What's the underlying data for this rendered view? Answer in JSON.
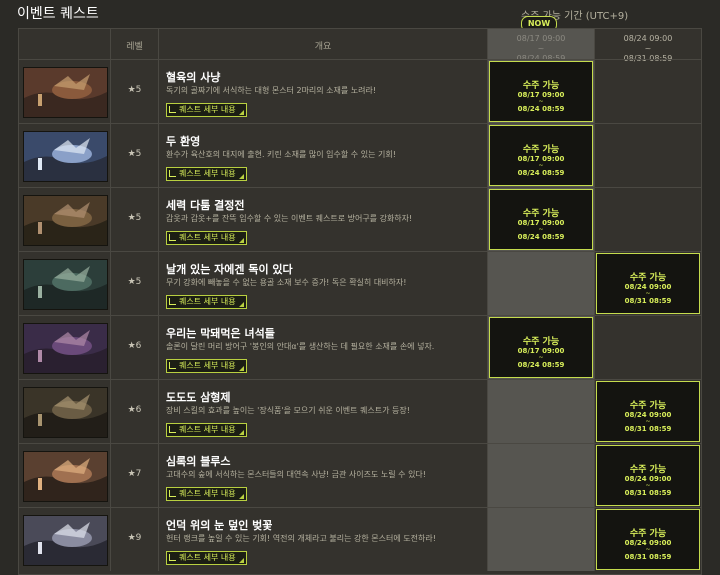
{
  "page_title": "이벤트 퀘스트",
  "period_caption": "수주 가능 기간 (UTC+9)",
  "now_badge": "NOW",
  "header": {
    "level": "레벨",
    "summary": "개요",
    "period1": {
      "start": "08/17 09:00",
      "tilde": "~",
      "end": "08/24 08:59"
    },
    "period2": {
      "start": "08/24 09:00",
      "tilde": "~",
      "end": "08/31 08:59"
    }
  },
  "detail_label": "퀘스트 세부 내용",
  "avail_label": "수주 가능",
  "quests": [
    {
      "name": "혈육의 사냥",
      "level": "★5",
      "desc": "독기의 골짜기에 서식하는 대형 몬스터 2마리의 소재를 노려라!",
      "period": 1,
      "start": "08/17 09:00",
      "tilde": "~",
      "end": "08/24 08:59"
    },
    {
      "name": "두 환영",
      "level": "★5",
      "desc": "환수가 육산호의 대지에 출현. 키린 소재를 많이 입수할 수 있는 기회!",
      "period": 1,
      "start": "08/17 09:00",
      "tilde": "~",
      "end": "08/24 08:59"
    },
    {
      "name": "세력 다툼 결정전",
      "level": "★5",
      "desc": "갑옷과 갑옷+를 잔뜩 입수할 수 있는 이벤트 퀘스트로 방어구를 강화하자!",
      "period": 1,
      "start": "08/17 09:00",
      "tilde": "~",
      "end": "08/24 08:59"
    },
    {
      "name": "날개 있는 자에겐 독이 있다",
      "level": "★5",
      "desc": "무기 강화에 빼놓을 수 없는 용골 소재 보수 증가! 독은 확실히 대비하자!",
      "period": 2,
      "start": "08/24 09:00",
      "tilde": "~",
      "end": "08/31 08:59"
    },
    {
      "name": "우리는 막돼먹은 녀석들",
      "level": "★6",
      "desc": "솔론이 달린 머리 방어구 '봉인의 안대α'를 생산하는 데 필요한 소재를 손에 넣자.",
      "period": 1,
      "start": "08/17 09:00",
      "tilde": "~",
      "end": "08/24 08:59"
    },
    {
      "name": "도도도 삼형제",
      "level": "★6",
      "desc": "장비 스킬의 효과를 높이는 '장식품'을 모으기 쉬운 이벤트 퀘스트가 등장!",
      "period": 2,
      "start": "08/24 09:00",
      "tilde": "~",
      "end": "08/31 08:59"
    },
    {
      "name": "심록의 블루스",
      "level": "★7",
      "desc": "고대수의 숲에 서식하는 몬스터들의 대연속 사냥! 금관 사이즈도 노릴 수 있다!",
      "period": 2,
      "start": "08/24 09:00",
      "tilde": "~",
      "end": "08/31 08:59"
    },
    {
      "name": "언덕 위의 눈 덮인 벚꽃",
      "level": "★9",
      "desc": "헌터 랭크를 높일 수 있는 기회! 역전의 개체라고 불리는 강한 몬스터에 도전하라!",
      "period": 2,
      "start": "08/24 09:00",
      "tilde": "~",
      "end": "08/31 08:59"
    }
  ]
}
